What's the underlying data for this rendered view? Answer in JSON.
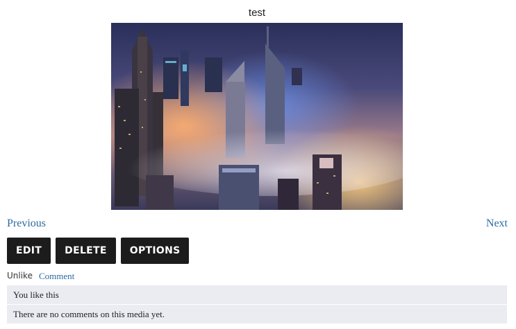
{
  "media": {
    "title": "test",
    "image_alt": "Foggy city skyline at night with skyscrapers"
  },
  "navigation": {
    "previous_label": "Previous",
    "next_label": "Next"
  },
  "actions": {
    "edit_label": "EDIT",
    "delete_label": "DELETE",
    "options_label": "OPTIONS"
  },
  "social": {
    "unlike_label": "Unlike",
    "comment_label": "Comment"
  },
  "info": {
    "likes_text": "You like this",
    "comments_text": "There are no comments on this media yet."
  },
  "colors": {
    "link": "#2a6aa0",
    "button_bg": "#1c1c1c",
    "panel_bg": "#ebecf2"
  }
}
